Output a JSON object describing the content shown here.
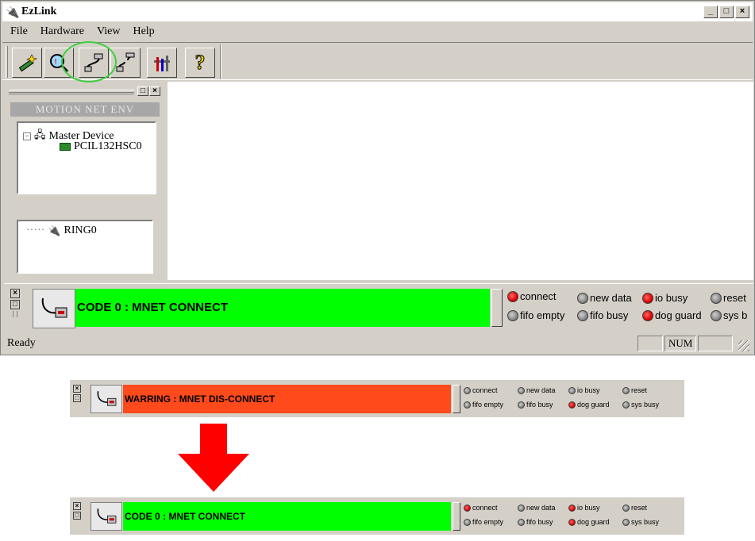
{
  "window": {
    "title": "EzLink",
    "controls": [
      "_",
      "□",
      "×"
    ]
  },
  "menu": [
    {
      "label": "File"
    },
    {
      "label": "Hardware"
    },
    {
      "label": "View"
    },
    {
      "label": "Help"
    }
  ],
  "toolbar": {
    "buttons": [
      {
        "icon": "wand-icon"
      },
      {
        "icon": "scan-icon"
      },
      {
        "icon": "connect-cable-icon"
      },
      {
        "icon": "disconnect-cable-icon"
      },
      {
        "icon": "tools-icon"
      },
      {
        "icon": "help-icon",
        "label": "?"
      }
    ]
  },
  "leftpanel": {
    "env_header": "MOTION NET ENV",
    "tree": {
      "expander": "−",
      "root": "Master Device",
      "child": "PCIL132HSC0"
    },
    "ring": "RING0"
  },
  "main_strip": {
    "code_text": "CODE 0 : MNET CONNECT",
    "code_color": "#00ff00",
    "leds": [
      {
        "label": "connect",
        "state": "red"
      },
      {
        "label": "new data",
        "state": "gray"
      },
      {
        "label": "io busy",
        "state": "red"
      },
      {
        "label": "reset",
        "state": "gray"
      },
      {
        "label": "fifo empty",
        "state": "gray"
      },
      {
        "label": "fifo busy",
        "state": "gray"
      },
      {
        "label": "dog guard",
        "state": "red"
      },
      {
        "label": "sys b",
        "state": "gray"
      }
    ]
  },
  "statusbar": {
    "text": "Ready",
    "num": "NUM"
  },
  "warning_strip": {
    "code_text": "WARRING : MNET DIS-CONNECT",
    "code_color": "#ff4a1c",
    "leds": [
      {
        "label": "connect",
        "state": "gray"
      },
      {
        "label": "new data",
        "state": "gray"
      },
      {
        "label": "io busy",
        "state": "gray"
      },
      {
        "label": "reset",
        "state": "gray"
      },
      {
        "label": "fifo empty",
        "state": "gray"
      },
      {
        "label": "fifo busy",
        "state": "gray"
      },
      {
        "label": "dog guard",
        "state": "red"
      },
      {
        "label": "sys busy",
        "state": "gray"
      }
    ]
  },
  "connect_strip": {
    "code_text": "CODE 0 : MNET CONNECT",
    "code_color": "#00ff00",
    "leds": [
      {
        "label": "connect",
        "state": "red"
      },
      {
        "label": "new data",
        "state": "gray"
      },
      {
        "label": "io busy",
        "state": "red"
      },
      {
        "label": "reset",
        "state": "gray"
      },
      {
        "label": "fifo empty",
        "state": "gray"
      },
      {
        "label": "fifo busy",
        "state": "gray"
      },
      {
        "label": "dog guard",
        "state": "red"
      },
      {
        "label": "sys busy",
        "state": "gray"
      }
    ]
  },
  "arrow_color": "#ff0000"
}
